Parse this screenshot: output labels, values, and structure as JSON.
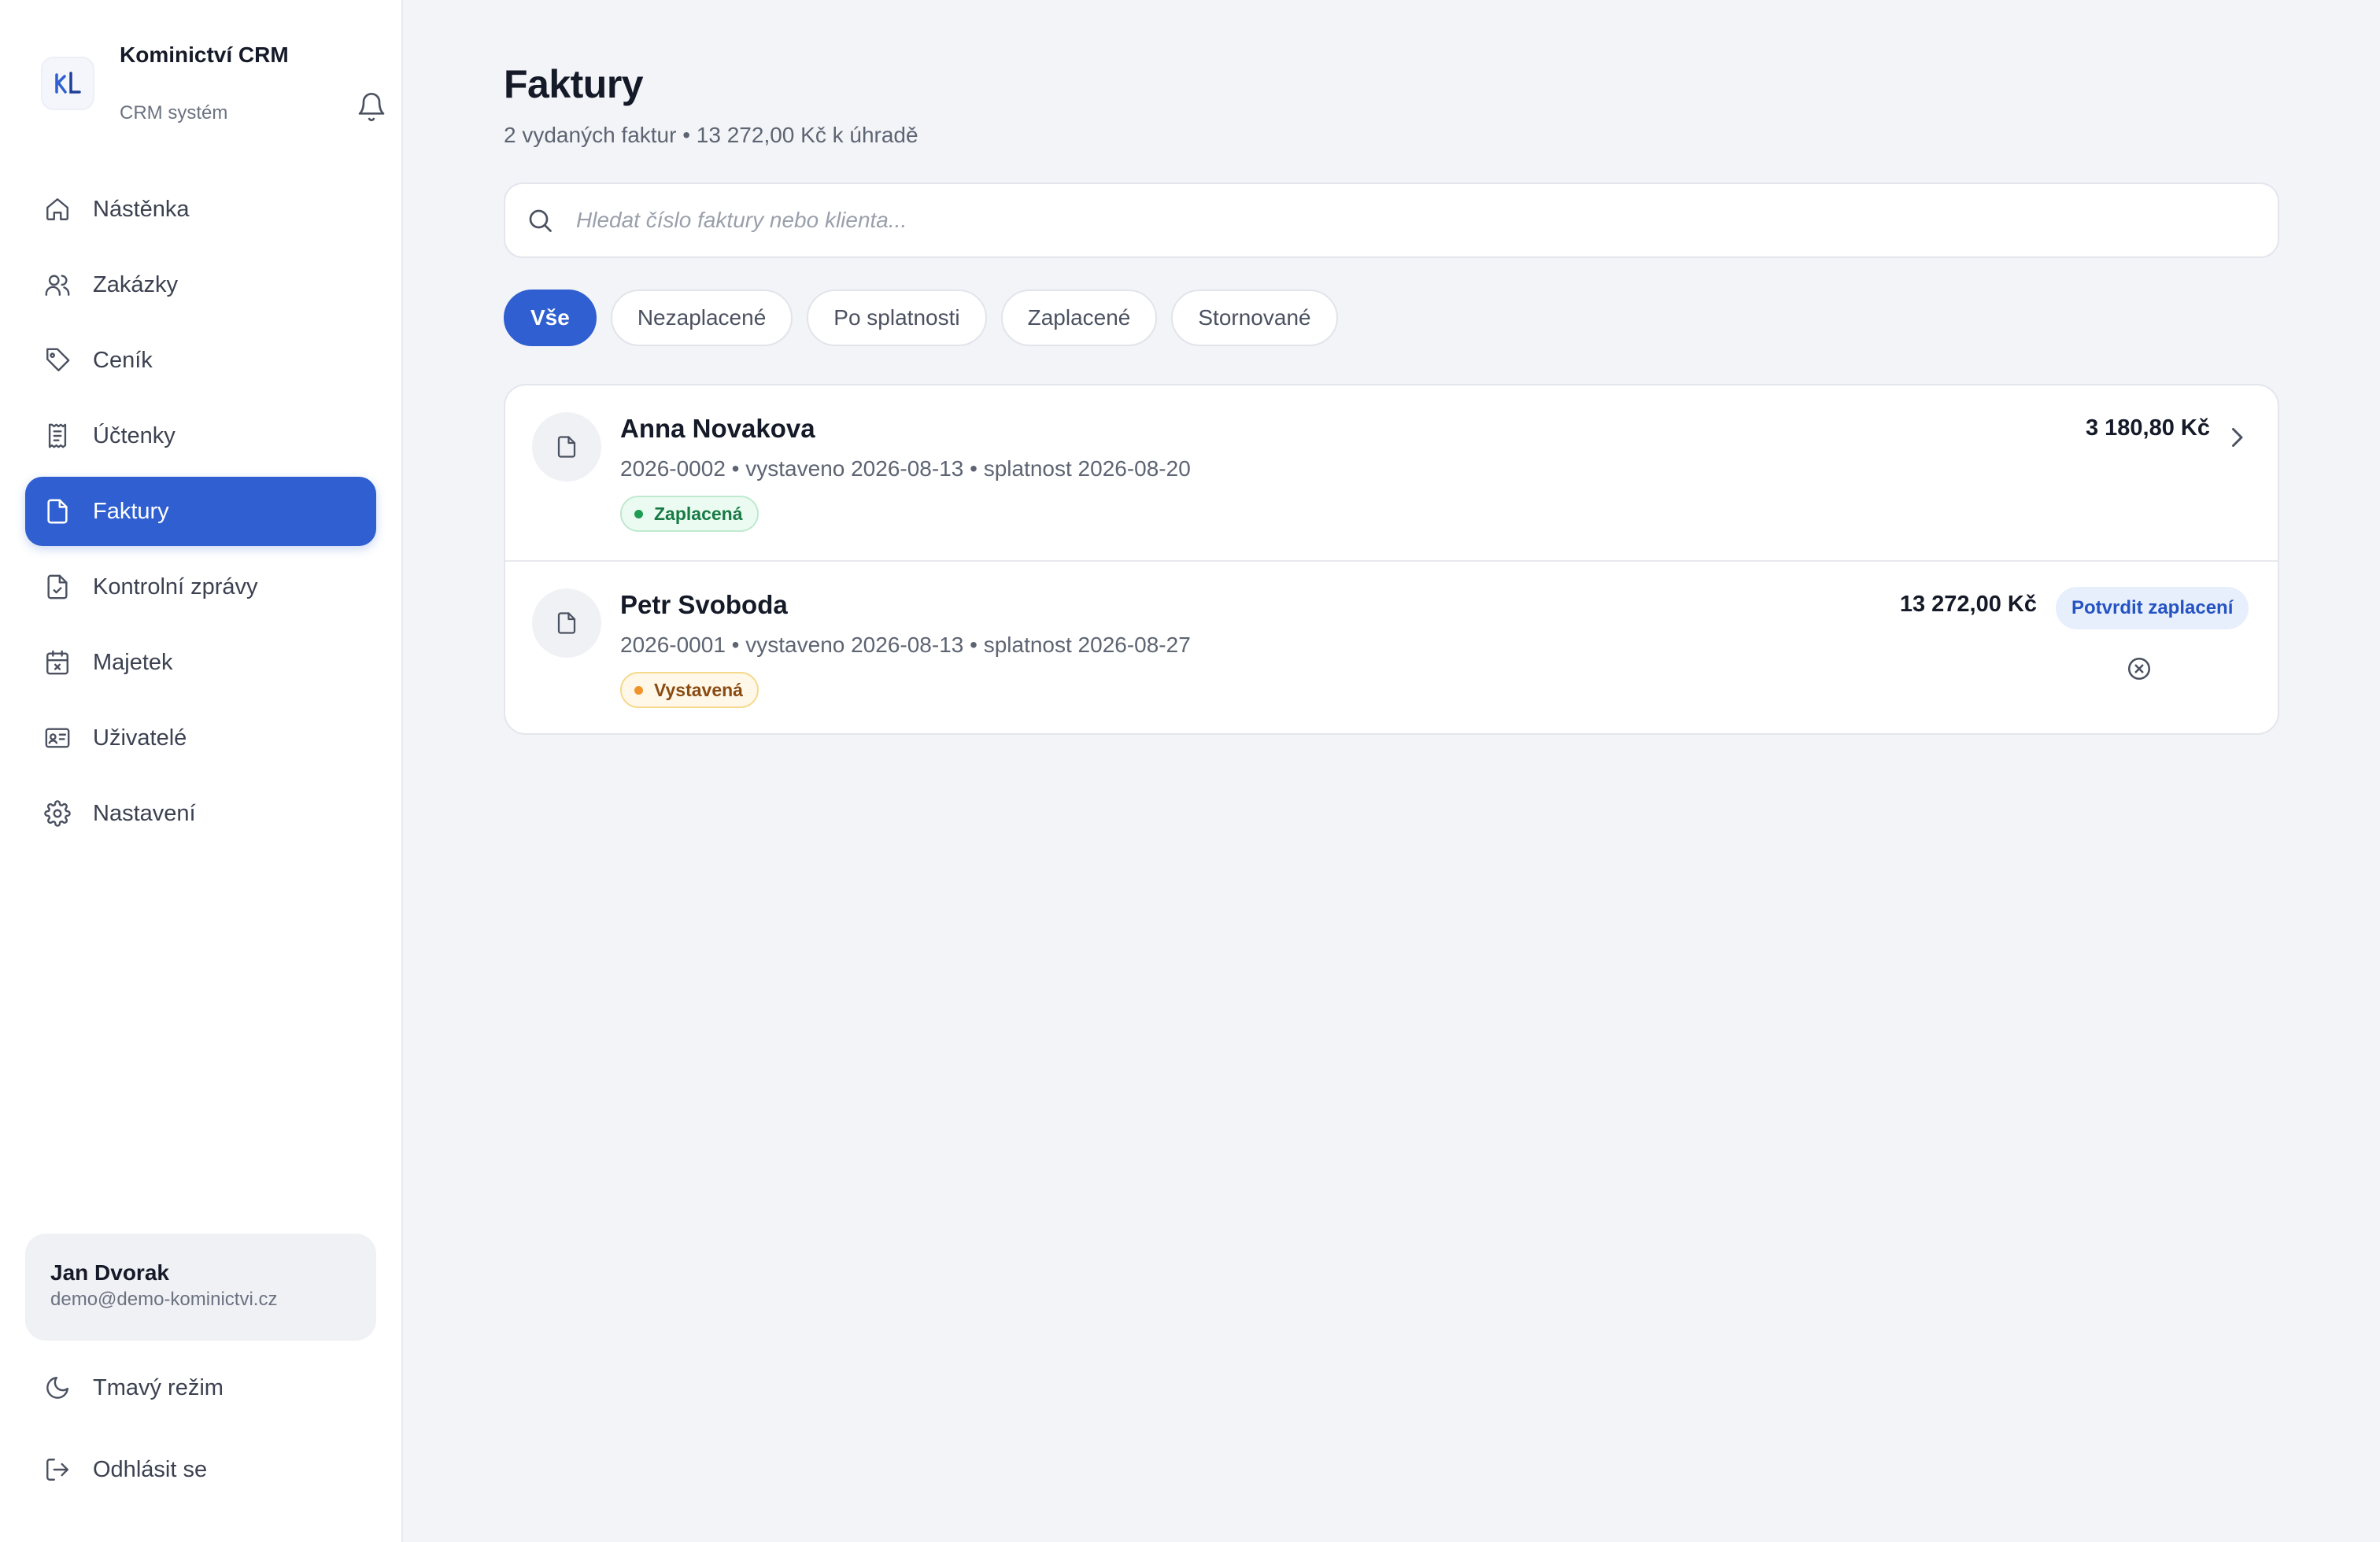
{
  "sidebar": {
    "brand_name": "Kominictví CRM",
    "brand_sub": "CRM systém",
    "items": [
      {
        "label": "Nástěnka",
        "icon": "home-icon"
      },
      {
        "label": "Zakázky",
        "icon": "users-icon"
      },
      {
        "label": "Ceník",
        "icon": "tag-icon"
      },
      {
        "label": "Účtenky",
        "icon": "receipt-icon"
      },
      {
        "label": "Faktury",
        "icon": "file-icon"
      },
      {
        "label": "Kontrolní zprávy",
        "icon": "file-check-icon"
      },
      {
        "label": "Majetek",
        "icon": "calendar-x-icon"
      },
      {
        "label": "Uživatelé",
        "icon": "id-card-icon"
      },
      {
        "label": "Nastavení",
        "icon": "gear-icon"
      }
    ],
    "active_item": "Faktury",
    "user": {
      "name": "Jan Dvorak",
      "email": "demo@demo-kominictvi.cz"
    },
    "dark_mode": "Tmavý režim",
    "logout": "Odhlásit se"
  },
  "main": {
    "title": "Faktury",
    "subtitle": "2 vydaných faktur • 13 272,00 Kč k úhradě",
    "search_placeholder": "Hledat číslo faktury nebo klienta...",
    "filters": [
      "Vše",
      "Nezaplacené",
      "Po splatnosti",
      "Zaplacené",
      "Stornované"
    ],
    "active_filter": "Vše",
    "invoices": [
      {
        "client": "Anna Novakova",
        "meta": "2026-0002 • vystaveno 2026-08-13 • splatnost 2026-08-20",
        "status": "Zaplacená",
        "amount": "3 180,80 Kč"
      },
      {
        "client": "Petr Svoboda",
        "meta": "2026-0001 • vystaveno 2026-08-13 • splatnost 2026-08-27",
        "status": "Vystavená",
        "amount": "13 272,00 Kč",
        "action": "Potvrdit zaplacení"
      }
    ]
  },
  "colors": {
    "accent": "#2f5fd0",
    "paid": "#1f9d55",
    "issued": "#f0932b",
    "background": "#f3f4f8"
  }
}
